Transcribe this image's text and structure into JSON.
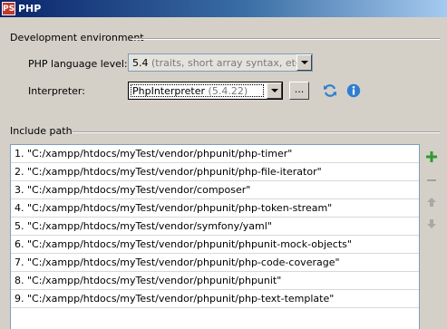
{
  "window": {
    "icon_text": "PS",
    "title": "PHP"
  },
  "dev_env": {
    "heading": "Development environment",
    "language_level_label": "PHP language level:",
    "language_level_value": "5.4",
    "language_level_hint": "(traits, short array syntax, etc.)",
    "interpreter_label": "Interpreter:",
    "interpreter_value": "PhpInterpreter",
    "interpreter_hint": "(5.4.22)",
    "browse_label": "..."
  },
  "include_path": {
    "heading": "Include path",
    "items": [
      "1. \"C:/xampp/htdocs/myTest/vendor/phpunit/php-timer\"",
      "2. \"C:/xampp/htdocs/myTest/vendor/phpunit/php-file-iterator\"",
      "3. \"C:/xampp/htdocs/myTest/vendor/composer\"",
      "4. \"C:/xampp/htdocs/myTest/vendor/phpunit/php-token-stream\"",
      "5. \"C:/xampp/htdocs/myTest/vendor/symfony/yaml\"",
      "6. \"C:/xampp/htdocs/myTest/vendor/phpunit/phpunit-mock-objects\"",
      "7. \"C:/xampp/htdocs/myTest/vendor/phpunit/php-code-coverage\"",
      "8. \"C:/xampp/htdocs/myTest/vendor/phpunit/phpunit\"",
      "9. \"C:/xampp/htdocs/myTest/vendor/phpunit/php-text-template\""
    ]
  },
  "icons": {
    "refresh": "refresh-icon",
    "info": "info-icon",
    "add": "add-icon",
    "remove": "remove-icon",
    "move_up": "arrow-up-icon",
    "move_down": "arrow-down-icon"
  },
  "colors": {
    "title_bar": "#0a246a",
    "add_green": "#2e9b2e",
    "info_blue": "#2f7fd0",
    "disabled": "#a0a0a0"
  }
}
